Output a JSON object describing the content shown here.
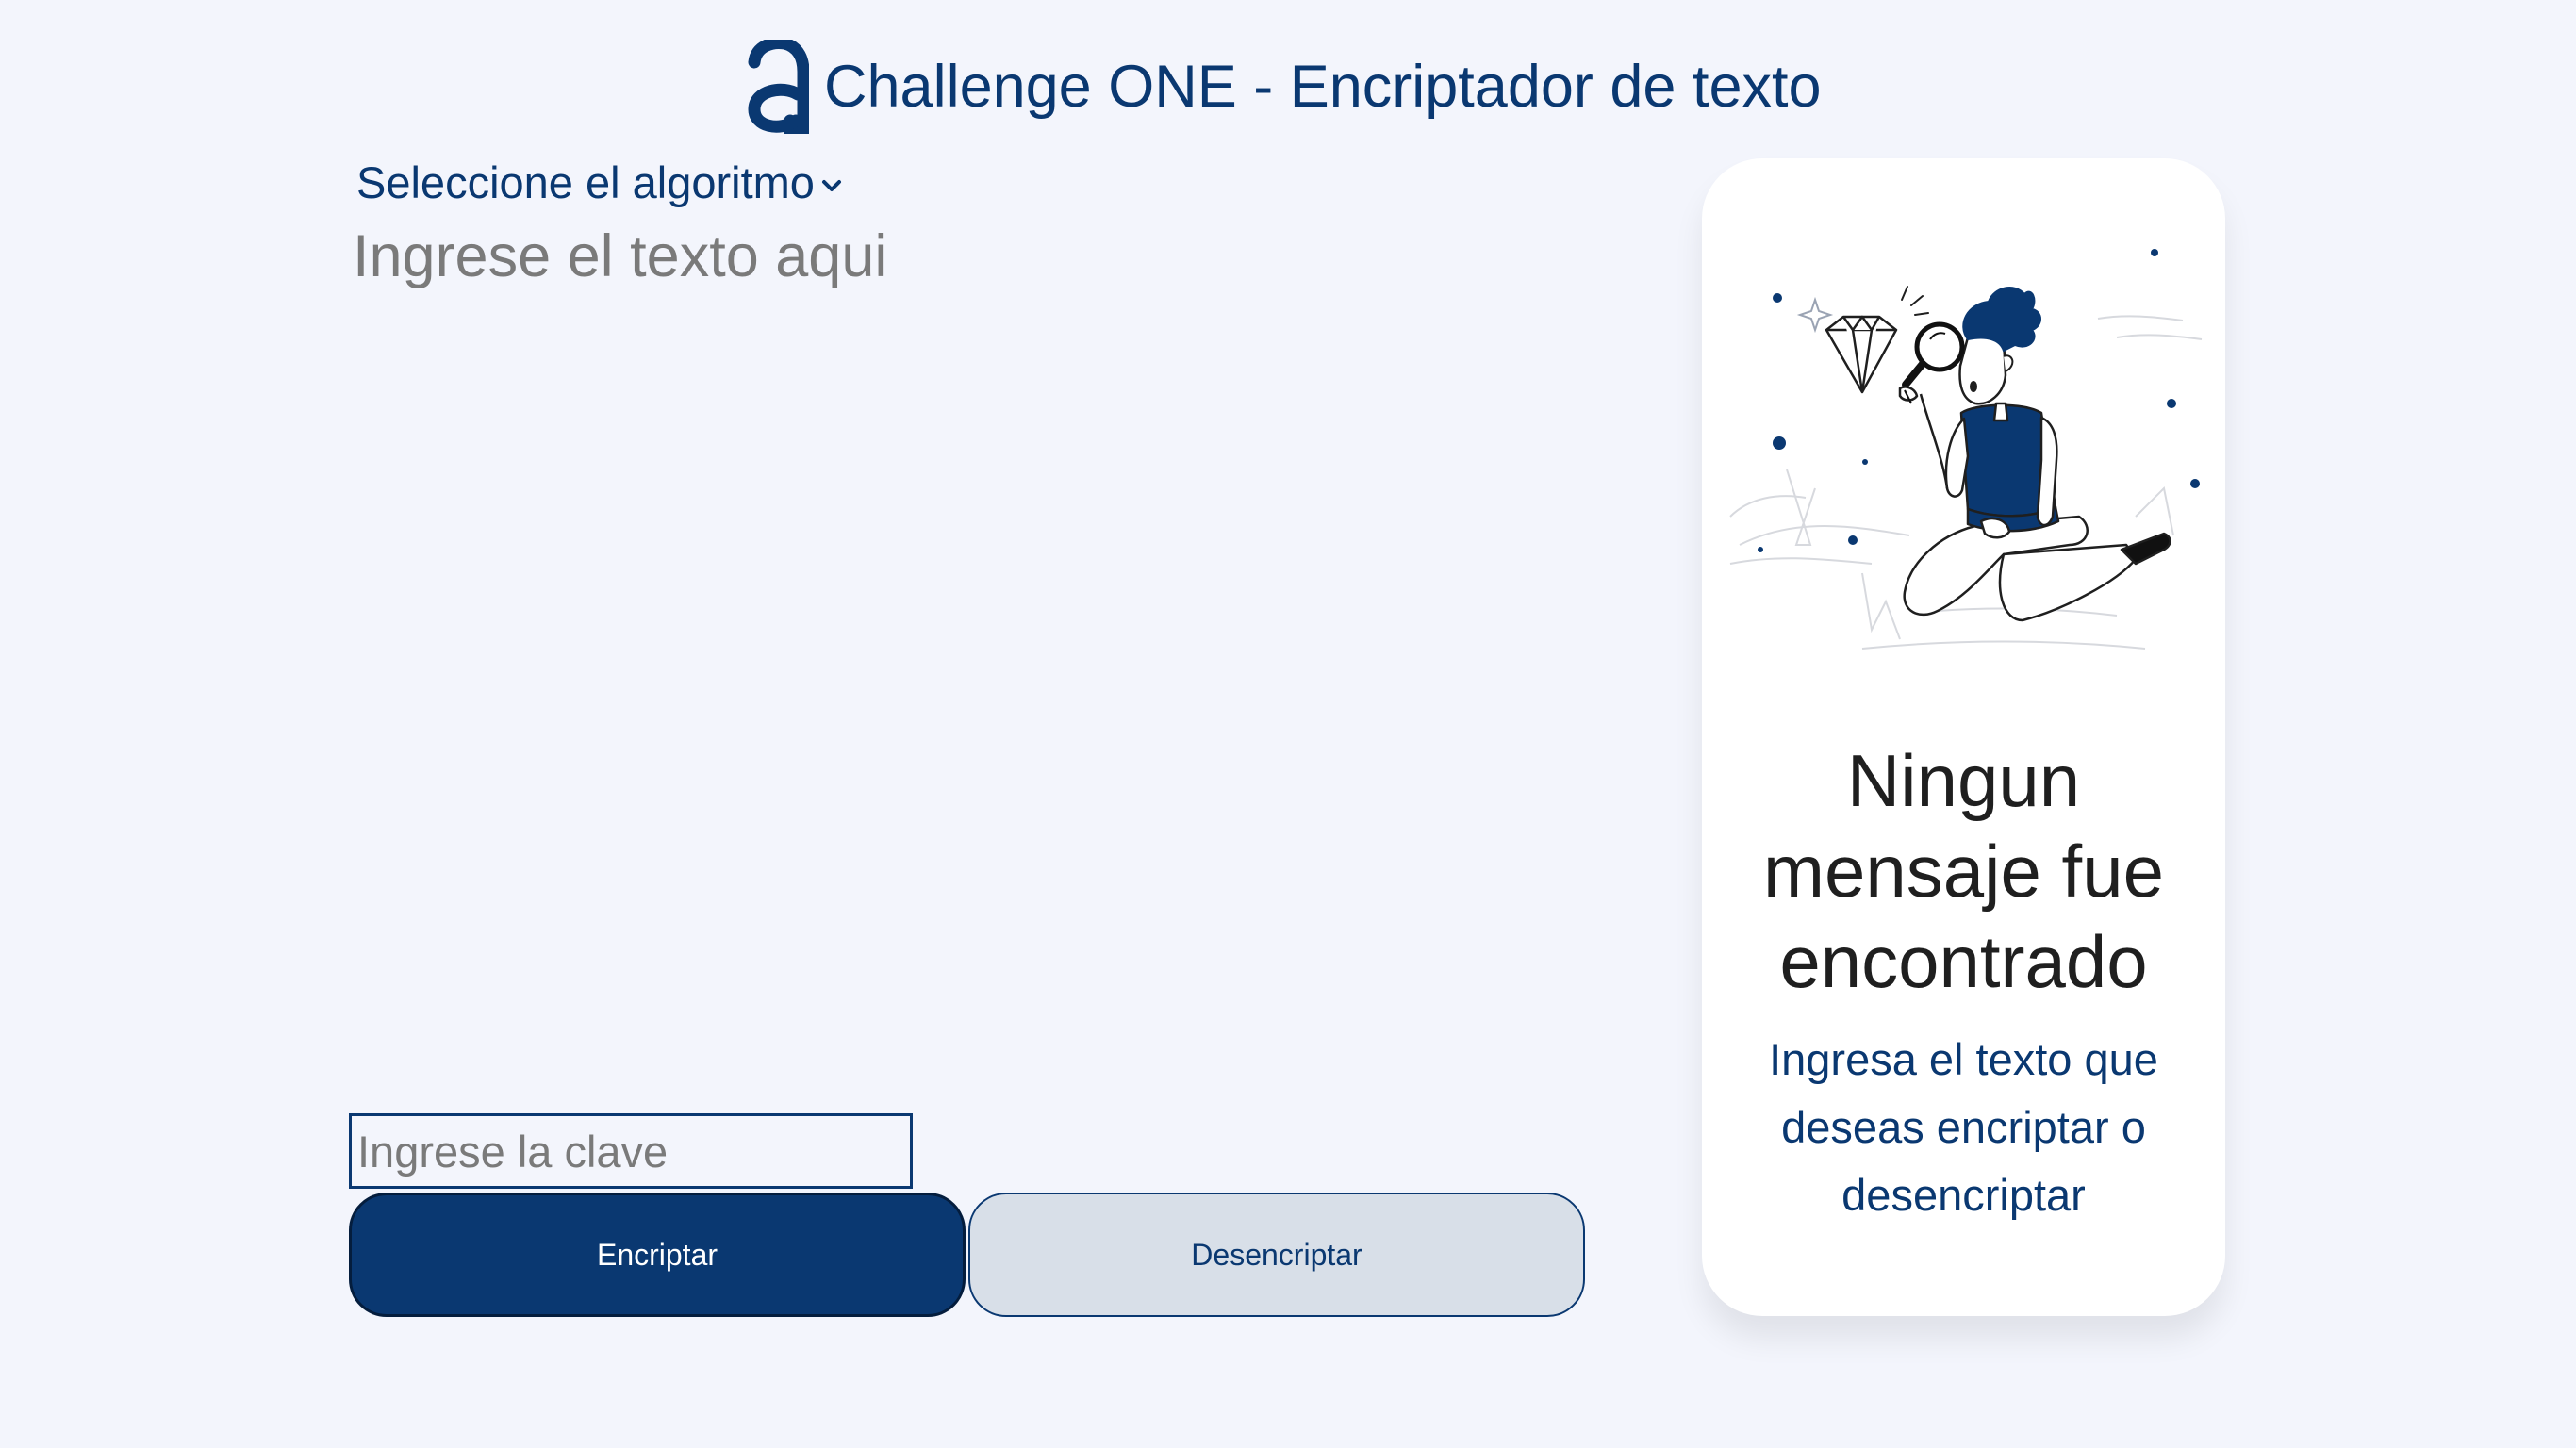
{
  "header": {
    "logo_icon": "alura-logo-icon",
    "title": "Challenge ONE - Encriptador de texto"
  },
  "algorithm": {
    "label": "Seleccione el algoritmo",
    "icon": "chevron-down-icon"
  },
  "input": {
    "text_placeholder": "Ingrese el texto aqui",
    "key_placeholder": "Ingrese la clave"
  },
  "buttons": {
    "encrypt_label": "Encriptar",
    "decrypt_label": "Desencriptar"
  },
  "result": {
    "illustration": "person-with-magnifier-illustration",
    "empty_title": "Ningun mensaje fue encontrado",
    "empty_subtitle": "Ingresa el texto que deseas encriptar o desencriptar"
  },
  "colors": {
    "background": "#f3f5fc",
    "primary": "#0a3871",
    "secondary_button": "#d8dfe8",
    "panel": "#ffffff",
    "placeholder": "#7a7a7a"
  }
}
